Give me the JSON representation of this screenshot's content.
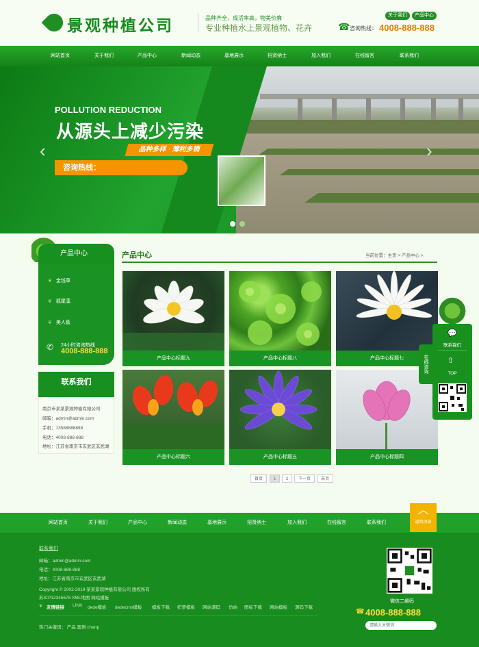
{
  "header": {
    "logo_text": "景观种植公司",
    "slogan_line1": "品种齐全，成活率高，物美价廉",
    "slogan_line2": "专业种植水上景观植物、花卉",
    "top_links": [
      "关于我们",
      "产品中心"
    ],
    "hotline_label": "咨询热线：",
    "hotline_number": "4008-888-888"
  },
  "nav": [
    "网站首页",
    "关于我们",
    "产品中心",
    "新闻动态",
    "基地展示",
    "招贤纳士",
    "加入我们",
    "在线留言",
    "联系我们"
  ],
  "banner": {
    "title_en": "POLLUTION REDUCTION",
    "title_cn": "从源头上减少污染",
    "tagline": "品种多样 · 薄利多销",
    "hotline_box": "咨询热线："
  },
  "sidebar": {
    "title": "产品中心",
    "items": [
      "金钱草",
      "狐尾藻",
      "美人蕉"
    ],
    "hotline_label": "24小时咨询热线",
    "hotline_number": "4008-888-888",
    "contact_title": "联系我们",
    "contact_lines": [
      "南京市某某景观种植有限公司",
      "邮箱：admin@admin.com",
      "手机：13588888888",
      "电话：4008-888-888",
      "地址：江苏省南京市玄武区玄武湖"
    ]
  },
  "main": {
    "title": "产品中心",
    "breadcrumb": "当前位置：主页 > 产品中心 >",
    "products": [
      {
        "caption": "产品中心标题九",
        "image": "white-water-lily"
      },
      {
        "caption": "产品中心标题八",
        "image": "green-aquatic-plant"
      },
      {
        "caption": "产品中心标题七",
        "image": "white-water-lily-2"
      },
      {
        "caption": "产品中心标题六",
        "image": "red-canna-flowers"
      },
      {
        "caption": "产品中心标题五",
        "image": "purple-water-lily"
      },
      {
        "caption": "产品中心标题四",
        "image": "pink-lotus"
      }
    ],
    "pagination": [
      "首页",
      "1",
      "2",
      "下一页",
      "末页"
    ]
  },
  "float_bar": {
    "tab_label": "在线咨询",
    "contact_label": "联系我们",
    "top_label": "TOP"
  },
  "footer": {
    "nav": [
      "网站首页",
      "关于我们",
      "产品中心",
      "新闻动态",
      "基地展示",
      "招贤纳士",
      "加入我们",
      "在线留言",
      "联系我们"
    ],
    "back_top": "返回顶部",
    "contact_heading": "联系我们",
    "lines": [
      "邮箱：admin@admin.com",
      "电话：4008-888-888",
      "地址：江苏省南京市玄武区玄武湖",
      "Copyright © 2002-2019 某某景观种植有限公司 版权所有",
      "苏ICP12345678  XML地图  网站模板"
    ],
    "friend_links_label": "友情链接",
    "friend_links_prefix": "LINK",
    "friend_links": [
      "dede模板",
      "dedecms模板",
      "模板下载",
      "织梦模板",
      "网站源码",
      "仿站",
      "图标下载",
      "网站模板",
      "源码下载"
    ],
    "hot_keywords": "热门关键词：  产品  案例  chanp",
    "qr_caption": "微信二维码",
    "phone": "4008-888-888",
    "search_placeholder": "请输入关键词"
  },
  "colors": {
    "primary_green": "#1b9324",
    "accent_orange": "#f39400",
    "accent_yellow": "#ffde3a"
  }
}
